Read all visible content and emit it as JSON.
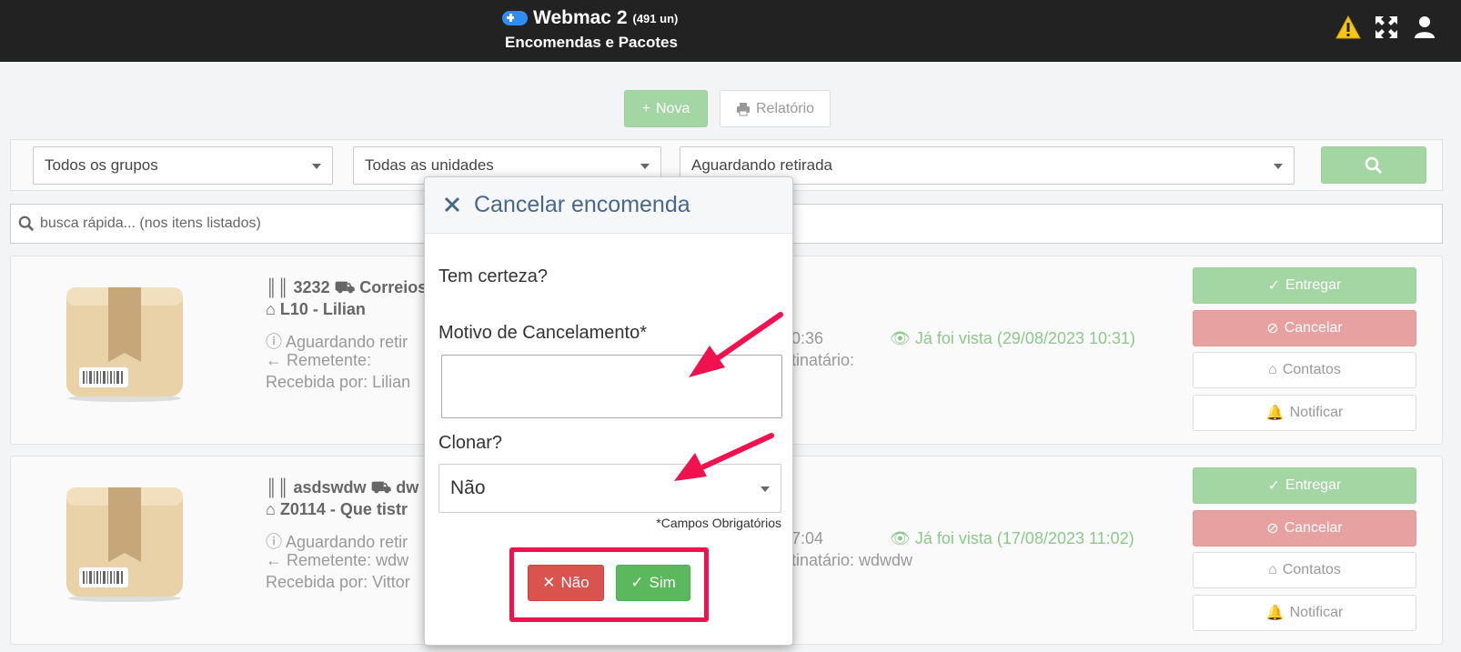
{
  "header": {
    "app_name": "Webmac 2",
    "app_count": "(491 un)",
    "subtitle": "Encomendas e Pacotes",
    "icons": [
      "gamepad-icon",
      "warning-icon",
      "fullscreen-icon",
      "user-icon"
    ]
  },
  "toolbar": {
    "nova_label": "Nova",
    "relatorio_label": "Relatório"
  },
  "filters": {
    "group_selected": "Todos os grupos",
    "unit_selected": "Todas as unidades",
    "status_selected": "Aguardando retirada"
  },
  "quick_search": {
    "placeholder": "busca rápida... (nos itens listados)"
  },
  "packages": [
    {
      "title_code": "3232",
      "title_carrier": "Correios",
      "unit": "L10 - Lilian",
      "status": "Aguardando retir",
      "time_fragment": "0:36",
      "seen": "Já foi vista (29/08/2023 10:31)",
      "sender": "Remetente:",
      "recipient": "tinatário:",
      "received_by": "Recebida por: Lilian"
    },
    {
      "title_code": "asdswdw",
      "title_carrier": "dw",
      "unit": "Z0114 - Que tistr",
      "status": "Aguardando retir",
      "time_fragment": "7:04",
      "seen": "Já foi vista (17/08/2023 11:02)",
      "sender": "Remetente: wdw",
      "recipient": "tinatário: wdwdw",
      "received_by": "Recebida por: Vittor"
    }
  ],
  "actions": {
    "entregar": "Entregar",
    "cancelar": "Cancelar",
    "contatos": "Contatos",
    "notificar": "Notificar"
  },
  "modal": {
    "title": "Cancelar encomenda",
    "question": "Tem certeza?",
    "reason_label": "Motivo de Cancelamento*",
    "reason_value": "",
    "clone_label": "Clonar?",
    "clone_selected": "Não",
    "required_note": "*Campos Obrigatórios",
    "no_label": "Não",
    "yes_label": "Sim"
  },
  "colors": {
    "topbar": "#222222",
    "green": "#5cb85c",
    "red": "#d9534f",
    "highlight": "#f0124f",
    "modal_title": "#4a6788"
  }
}
